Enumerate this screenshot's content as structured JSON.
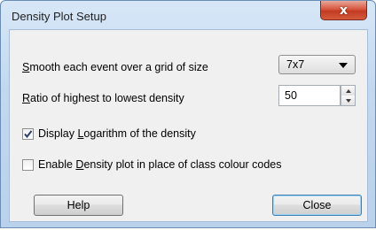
{
  "window": {
    "title": "Density Plot Setup",
    "close_glyph": "x"
  },
  "smooth": {
    "label_pre": "",
    "label_mnemonic": "S",
    "label_post": "mooth each event over a grid of size",
    "selected": "7x7"
  },
  "ratio": {
    "label_pre": "",
    "label_mnemonic": "R",
    "label_post": "atio of highest to lowest density",
    "value": "50"
  },
  "log_checkbox": {
    "checked": true,
    "label_pre": "Display ",
    "label_mnemonic": "L",
    "label_post": "ogarithm of the density"
  },
  "density_checkbox": {
    "checked": false,
    "label_pre": "Enable ",
    "label_mnemonic": "D",
    "label_post": "ensity plot in place of class colour codes"
  },
  "buttons": {
    "help": "Help",
    "close": "Close"
  }
}
